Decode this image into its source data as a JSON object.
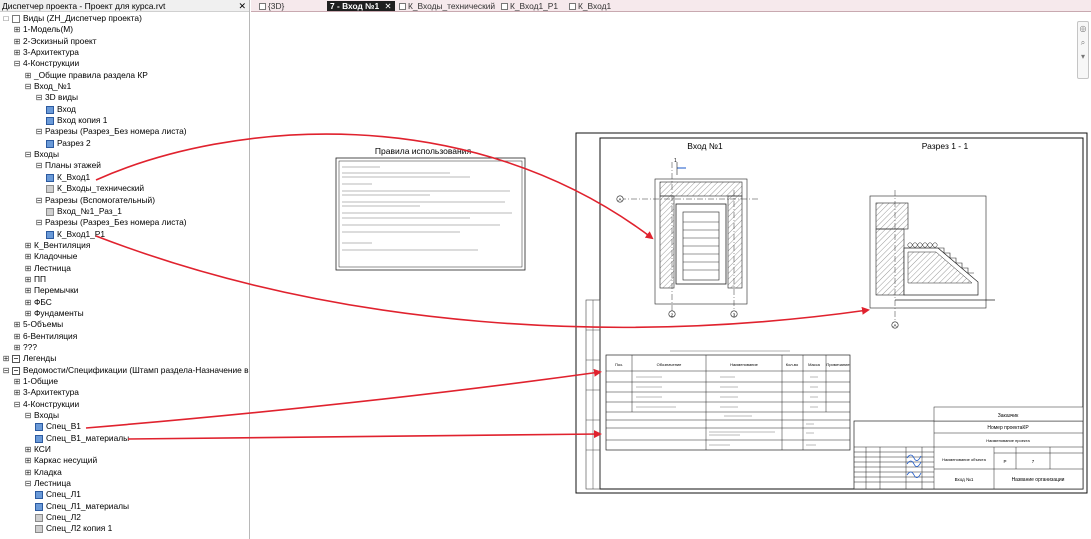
{
  "browser": {
    "title": "Диспетчер проекта - Проект для курса.rvt",
    "close_glyph": "✕",
    "rows": [
      {
        "level": 0,
        "toggle": "□",
        "icon": "views",
        "label": "Виды (ZH_Диспетчер проекта)"
      },
      {
        "level": 1,
        "toggle": "⊞",
        "label": "1-Модель(М)"
      },
      {
        "level": 1,
        "toggle": "⊞",
        "label": "2-Эскизный проект"
      },
      {
        "level": 1,
        "toggle": "⊞",
        "label": "3-Архитектура"
      },
      {
        "level": 1,
        "toggle": "⊟",
        "label": "4-Конструкции"
      },
      {
        "level": 2,
        "toggle": "⊞",
        "label": "_Общие правила раздела КР"
      },
      {
        "level": 2,
        "toggle": "⊟",
        "label": "Вход_№1"
      },
      {
        "level": 3,
        "toggle": "⊟",
        "label": "3D виды"
      },
      {
        "level": 4,
        "icon": "view",
        "label": "Вход"
      },
      {
        "level": 4,
        "icon": "view",
        "label": "Вход копия 1"
      },
      {
        "level": 3,
        "toggle": "⊟",
        "label": "Разрезы (Разрез_Без номера листа)"
      },
      {
        "level": 4,
        "icon": "view",
        "label": "Разрез 2"
      },
      {
        "level": 2,
        "toggle": "⊟",
        "label": "Входы"
      },
      {
        "level": 3,
        "toggle": "⊟",
        "label": "Планы этажей"
      },
      {
        "level": 4,
        "icon": "view",
        "label": "К_Вход1"
      },
      {
        "level": 4,
        "icon": "view-grey",
        "label": "К_Входы_технический"
      },
      {
        "level": 3,
        "toggle": "⊟",
        "label": "Разрезы (Вспомогательный)"
      },
      {
        "level": 4,
        "icon": "view-grey",
        "label": "Вход_№1_Раз_1"
      },
      {
        "level": 3,
        "toggle": "⊟",
        "label": "Разрезы (Разрез_Без номера листа)"
      },
      {
        "level": 4,
        "icon": "view",
        "label": "К_Вход1_Р1"
      },
      {
        "level": 2,
        "toggle": "⊞",
        "label": "К_Вентиляция"
      },
      {
        "level": 2,
        "toggle": "⊞",
        "label": "Кладочные"
      },
      {
        "level": 2,
        "toggle": "⊞",
        "label": "Лестница"
      },
      {
        "level": 2,
        "toggle": "⊞",
        "label": "ПП"
      },
      {
        "level": 2,
        "toggle": "⊞",
        "label": "Перемычки"
      },
      {
        "level": 2,
        "toggle": "⊞",
        "label": "ФБС"
      },
      {
        "level": 2,
        "toggle": "⊞",
        "label": "Фундаменты"
      },
      {
        "level": 1,
        "toggle": "⊞",
        "label": "5-Объемы"
      },
      {
        "level": 1,
        "toggle": "⊞",
        "label": "6-Вентиляция"
      },
      {
        "level": 1,
        "toggle": "⊞",
        "label": "???"
      },
      {
        "level": 0,
        "toggle": "⊞",
        "icon": "legend",
        "label": "Легенды"
      },
      {
        "level": 0,
        "toggle": "⊟",
        "icon": "sched",
        "label": "Ведомости/Спецификации (Штамп раздела-Назначение вида)"
      },
      {
        "level": 1,
        "toggle": "⊞",
        "label": "1-Общие"
      },
      {
        "level": 1,
        "toggle": "⊞",
        "label": "3-Архитектура"
      },
      {
        "level": 1,
        "toggle": "⊟",
        "label": "4-Конструкции"
      },
      {
        "level": 2,
        "toggle": "⊟",
        "label": "Входы"
      },
      {
        "level": 3,
        "icon": "view",
        "label": "Спец_В1"
      },
      {
        "level": 3,
        "icon": "view",
        "label": "Спец_В1_материалы"
      },
      {
        "level": 2,
        "toggle": "⊞",
        "label": "КСИ"
      },
      {
        "level": 2,
        "toggle": "⊞",
        "label": "Каркас несущий"
      },
      {
        "level": 2,
        "toggle": "⊞",
        "label": "Кладка"
      },
      {
        "level": 2,
        "toggle": "⊟",
        "label": "Лестница"
      },
      {
        "level": 3,
        "icon": "view",
        "label": "Спец_Л1"
      },
      {
        "level": 3,
        "icon": "view",
        "label": "Спец_Л1_материалы"
      },
      {
        "level": 3,
        "icon": "view-grey",
        "label": "Спец_Л2"
      },
      {
        "level": 3,
        "icon": "view-grey",
        "label": "Спец_Л2 копия 1"
      }
    ]
  },
  "tabs": [
    {
      "label": "{3D}",
      "active": false
    },
    {
      "label": "7 - Вход №1",
      "active": true,
      "close": "✕"
    },
    {
      "label": "К_Входы_технический",
      "active": false
    },
    {
      "label": "К_Вход1_Р1",
      "active": false
    },
    {
      "label": "К_Вход1",
      "active": false
    }
  ],
  "legend_panel": {
    "title": "Правила использования"
  },
  "sheet": {
    "view1_title": "Вход №1",
    "view2_title": "Разрез 1 - 1",
    "grid_a": "А",
    "grid_1": "1",
    "grid_2": "2",
    "grid_3": "3",
    "schedule": {
      "headers": [
        "Поз.",
        "Обозначение",
        "Наименование",
        "Кол-во",
        "Масса",
        "Примечание"
      ]
    },
    "stamp": {
      "customer": "Заказчик",
      "project_number": "Номер проектаКР",
      "project_name": "Наименование проекта",
      "sheet_name": "Наименование объекта",
      "view_name": "Вход №1",
      "org_name": "Название организации",
      "stage": "Р",
      "sheet_num": "7"
    }
  },
  "colors": {
    "arrow": "#e0222e",
    "tab_bg": "#f6e9ec"
  }
}
